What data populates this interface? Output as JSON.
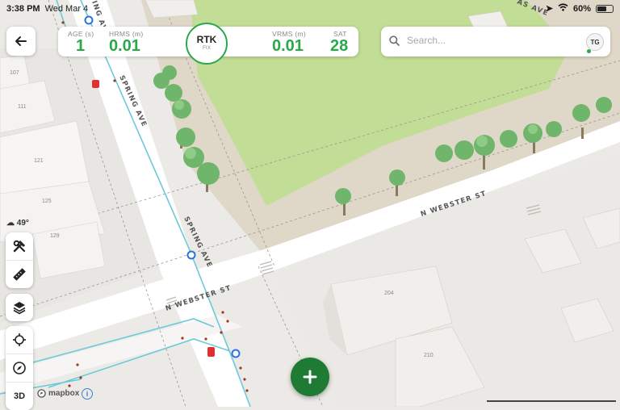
{
  "status_bar": {
    "time": "3:38 PM",
    "date": "Wed Mar 4",
    "battery_percent": "60%",
    "battery_level": 0.6
  },
  "gnss_bar": {
    "age_label": "AGE (s)",
    "age_value": "1",
    "hrms_label": "HRMS (m)",
    "hrms_value": "0.01",
    "fix_main": "RTK",
    "fix_sub": "FIX",
    "vrms_label": "VRMS (m)",
    "vrms_value": "0.01",
    "sat_label": "SAT",
    "sat_value": "28"
  },
  "search": {
    "placeholder": "Search...",
    "avatar_initials": "TG"
  },
  "weather": {
    "temperature": "49°"
  },
  "map": {
    "streets": {
      "spring_ave_top": "SPRING AVE",
      "spring_ave_mid": "SPRING AVE",
      "n_webster_st_right": "N WEBSTER ST",
      "n_webster_st_left": "N WEBSTER ST",
      "top_left_partial": "ING AVE",
      "top_right_partial": "AS AVE"
    },
    "building_numbers": {
      "b107": "107",
      "b111": "111",
      "b121": "121",
      "b125": "125",
      "b129": "129",
      "b204": "204",
      "b210": "210"
    },
    "attribution": "mapbox",
    "info_glyph": "i"
  },
  "toolbar": {
    "tools_icon": "hammer-wrench-icon",
    "measure_icon": "ruler-icon",
    "layers_icon": "layers-icon",
    "locate_icon": "crosshair-icon",
    "compass_icon": "compass-icon",
    "view_3d_label": "3D"
  },
  "colors": {
    "accent_green": "#2aa84a",
    "fab_green": "#1f7a33",
    "park_green": "#c2dd96",
    "utility_line": "#6cc9d9",
    "marker_blue": "#2a73d9",
    "hydrant_red": "#e03030"
  }
}
